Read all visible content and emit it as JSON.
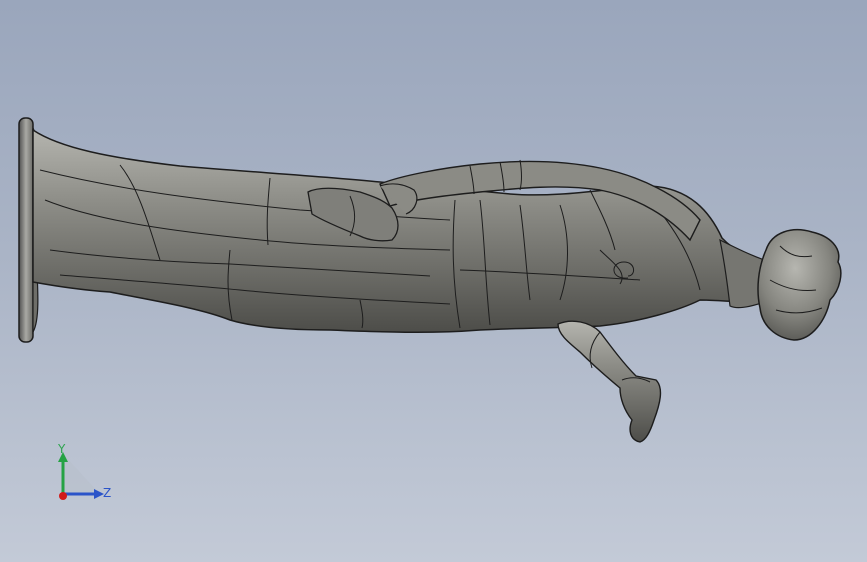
{
  "viewport": {
    "background_top": "#9aa6bc",
    "background_bottom": "#c3cad7",
    "model": {
      "name": "statue",
      "color": "#7d7d78",
      "edge_color": "#1d1d1d"
    }
  },
  "triad": {
    "y_label": "Y",
    "z_label": "Z",
    "colors": {
      "x": "#d11a1a",
      "y": "#25a244",
      "z": "#2b54c9"
    }
  }
}
